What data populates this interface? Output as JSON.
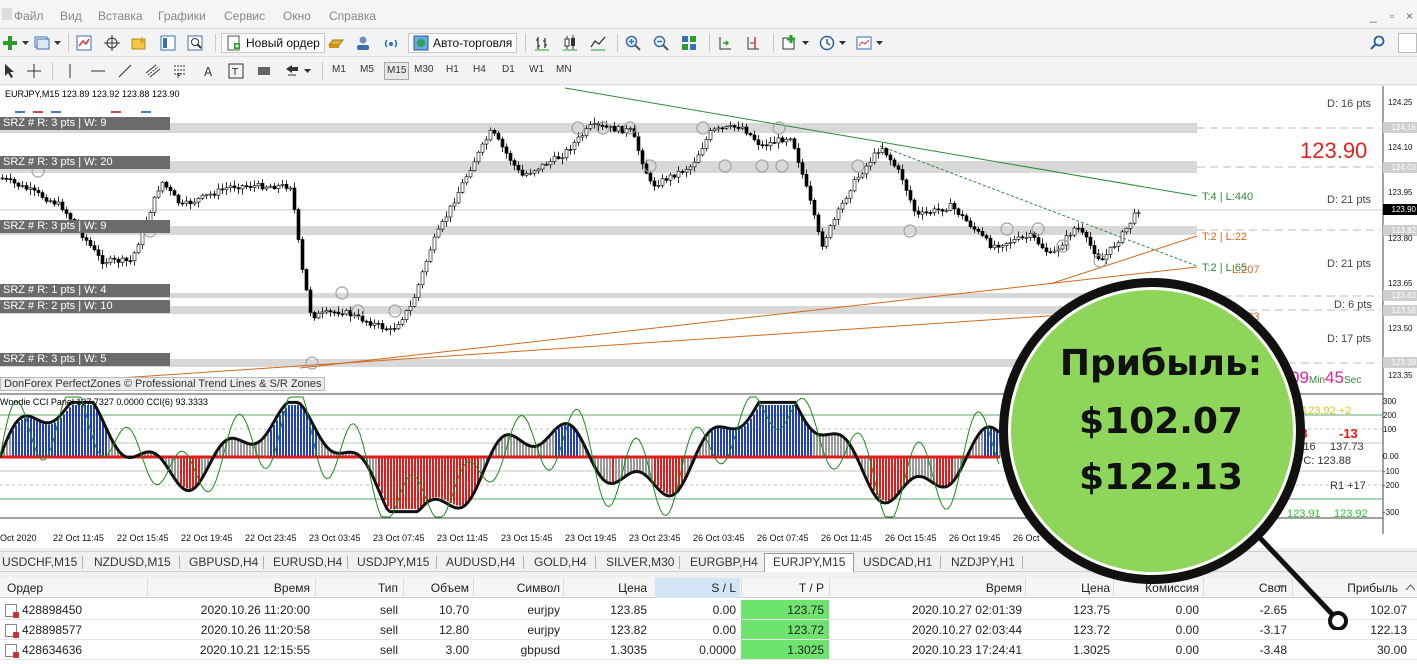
{
  "menu": [
    "Файл",
    "Вид",
    "Вставка",
    "Графики",
    "Сервис",
    "Окно",
    "Справка"
  ],
  "window_controls": [
    "_",
    "▫",
    "×"
  ],
  "toolbar": {
    "new_order_label": "Новый ордер",
    "autotrade_label": "Авто-торговля"
  },
  "timeframes": [
    "M1",
    "M5",
    "M15",
    "M30",
    "H1",
    "H4",
    "D1",
    "W1",
    "MN"
  ],
  "active_timeframe": "M15",
  "chart": {
    "title": "EURJPY,M15  123.89 123.92 123.88 123.90",
    "big_price": "123.90",
    "indicator_credit": "DonForex PerfectZones © Professional Trend Lines & S/R Zones",
    "cci_title": "Woodie CCI Panel 137.7327 0.0000  CCI(6) 93.3333",
    "timer": {
      "min": "09",
      "min_label": "Min",
      "sec": "45",
      "sec_label": "Sec"
    },
    "zones": [
      "SRZ # R: 3 pts  |  W: 9",
      "SRZ # R: 3 pts  |  W: 20",
      "SRZ # R: 3 pts  |  W: 9",
      "SRZ # R: 1 pts  |  W: 4",
      "SRZ # R: 2 pts  |  W: 10",
      "SRZ # R: 3 pts  |  W: 5"
    ],
    "distances": [
      "D: 16 pts",
      "D: 21 pts",
      "D: 21 pts",
      "D: 6 pts",
      "D: 17 pts"
    ],
    "trend_labels": [
      "T:4  |  L:440",
      "T:2  |  L:22",
      "T:2  |  L:65",
      "L:207",
      "L:733"
    ],
    "price_axis": [
      "124.25",
      "124.16",
      "124.10",
      "124.03",
      "123.95",
      "123.90",
      "123.82",
      "123.80",
      "123.65",
      "123.62",
      "123.56",
      "123.50",
      "123.39",
      "123.35"
    ],
    "cci_axis": [
      "300",
      "200",
      "100",
      "0.00",
      "-100",
      "-200",
      "-300"
    ],
    "cci_notes": {
      "hh": "HH: 123.92  +2",
      "neg8": "-8",
      "neg13": "-13",
      "v1": "131.16",
      "v2": "137.73",
      "pc": "PC: 123.88",
      "r1": "R1  +17",
      "lo": "123.91",
      "hi": "123.92"
    },
    "time_axis": [
      "Oct 2020",
      "22 Oct 11:45",
      "22 Oct 15:45",
      "22 Oct 19:45",
      "22 Oct 23:45",
      "23 Oct 03:45",
      "23 Oct 07:45",
      "23 Oct 11:45",
      "23 Oct 15:45",
      "23 Oct 19:45",
      "23 Oct 23:45",
      "26 Oct 03:45",
      "26 Oct 07:45",
      "26 Oct 11:45",
      "26 Oct 15:45",
      "26 Oct 19:45",
      "26 Oct"
    ]
  },
  "symbol_tabs": [
    "USDCHF,M15",
    "NZDUSD,M15",
    "GBPUSD,H4",
    "EURUSD,H4",
    "USDJPY,M15",
    "AUDUSD,H4",
    "GOLD,H4",
    "SILVER,M30",
    "EURGBP,H4",
    "EURJPY,M15",
    "USDCAD,H1",
    "NZDJPY,H1"
  ],
  "active_symbol_tab": "EURJPY,M15",
  "orders": {
    "headers": [
      "Ордер",
      "Время",
      "Тип",
      "Объем",
      "Символ",
      "Цена",
      "S / L",
      "T / P",
      "Время",
      "Цена",
      "Комиссия",
      "Своп",
      "Прибыль"
    ],
    "rows": [
      [
        "428898450",
        "2020.10.26 11:20:00",
        "sell",
        "10.70",
        "eurjpy",
        "123.85",
        "0.00",
        "123.75",
        "2020.10.27 02:01:39",
        "123.75",
        "0.00",
        "-2.65",
        "102.07"
      ],
      [
        "428898577",
        "2020.10.26 11:20:58",
        "sell",
        "12.80",
        "eurjpy",
        "123.82",
        "0.00",
        "123.72",
        "2020.10.27 02:03:44",
        "123.72",
        "0.00",
        "-3.17",
        "122.13"
      ],
      [
        "428634636",
        "2020.10.21 12:15:55",
        "sell",
        "3.00",
        "gbpusd",
        "1.3035",
        "0.0000",
        "1.3025",
        "2020.10.23 17:24:41",
        "1.3025",
        "0.00",
        "-3.48",
        "30.00"
      ]
    ]
  },
  "overlay": {
    "title": "Прибыль:",
    "amount1": "$102.07",
    "amount2": "$122.13"
  },
  "colors": {
    "bull_candle": "#000000",
    "cci_blue": "#1f3fbf",
    "cci_red": "#e21b1b",
    "cci_gray": "#9a9a9a",
    "tp_green": "#6ee36e",
    "overlay_green": "#8ed65a",
    "big_price_red": "#e62020"
  }
}
